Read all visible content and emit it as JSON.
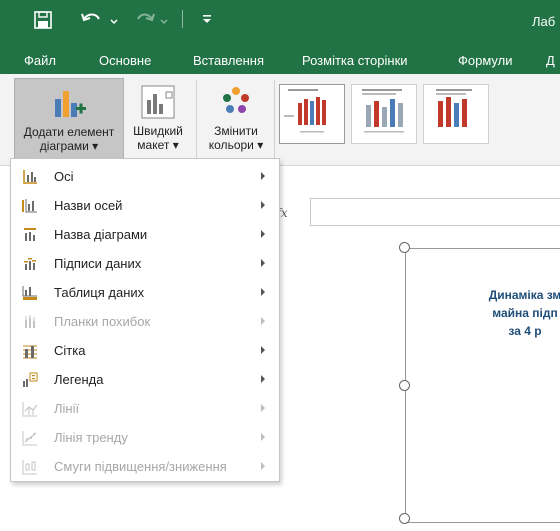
{
  "app": {
    "title": "Лаб"
  },
  "quick_access": {
    "save_icon": "save-icon",
    "undo_icon": "undo-icon",
    "redo_icon": "redo-icon",
    "customize_icon": "customize-qat-icon"
  },
  "tabs": [
    {
      "label": "Файл"
    },
    {
      "label": "Основне"
    },
    {
      "label": "Вставлення"
    },
    {
      "label": "Розмітка сторінки"
    },
    {
      "label": "Формули"
    },
    {
      "label": "Д"
    }
  ],
  "ribbon": {
    "add_element": {
      "line1": "Додати елемент",
      "line2": "діаграми ▾"
    },
    "quick_layout": {
      "line1": "Швидкий",
      "line2": "макет ▾"
    },
    "change_colors": {
      "line1": "Змінити",
      "line2": "кольори ▾"
    },
    "colors": {
      "accent": "#217346",
      "bar_red": "#c0392b",
      "bar_blue": "#4a7db8",
      "bar_gray": "#9aa7b4"
    }
  },
  "formula_bar": {
    "fx_label": "fx",
    "value": ""
  },
  "chart": {
    "title_lines": [
      "Динаміка зм",
      "майна підп",
      "за 4 р"
    ],
    "title_color": "#1f4e79"
  },
  "menu": {
    "items": [
      {
        "label": "Осі",
        "icon": "axes-icon",
        "enabled": true
      },
      {
        "label": "Назви осей",
        "icon": "axis-titles-icon",
        "enabled": true
      },
      {
        "label": "Назва діаграми",
        "icon": "chart-title-icon",
        "enabled": true
      },
      {
        "label": "Підписи даних",
        "icon": "data-labels-icon",
        "enabled": true
      },
      {
        "label": "Таблиця даних",
        "icon": "data-table-icon",
        "enabled": true
      },
      {
        "label": "Планки похибок",
        "icon": "error-bars-icon",
        "enabled": false
      },
      {
        "label": "Сітка",
        "icon": "gridlines-icon",
        "enabled": true
      },
      {
        "label": "Легенда",
        "icon": "legend-icon",
        "enabled": true
      },
      {
        "label": "Лінії",
        "icon": "lines-icon",
        "enabled": false
      },
      {
        "label": "Лінія тренду",
        "icon": "trendline-icon",
        "enabled": false
      },
      {
        "label": "Смуги підвищення/зниження",
        "icon": "up-down-bars-icon",
        "enabled": false
      }
    ]
  }
}
